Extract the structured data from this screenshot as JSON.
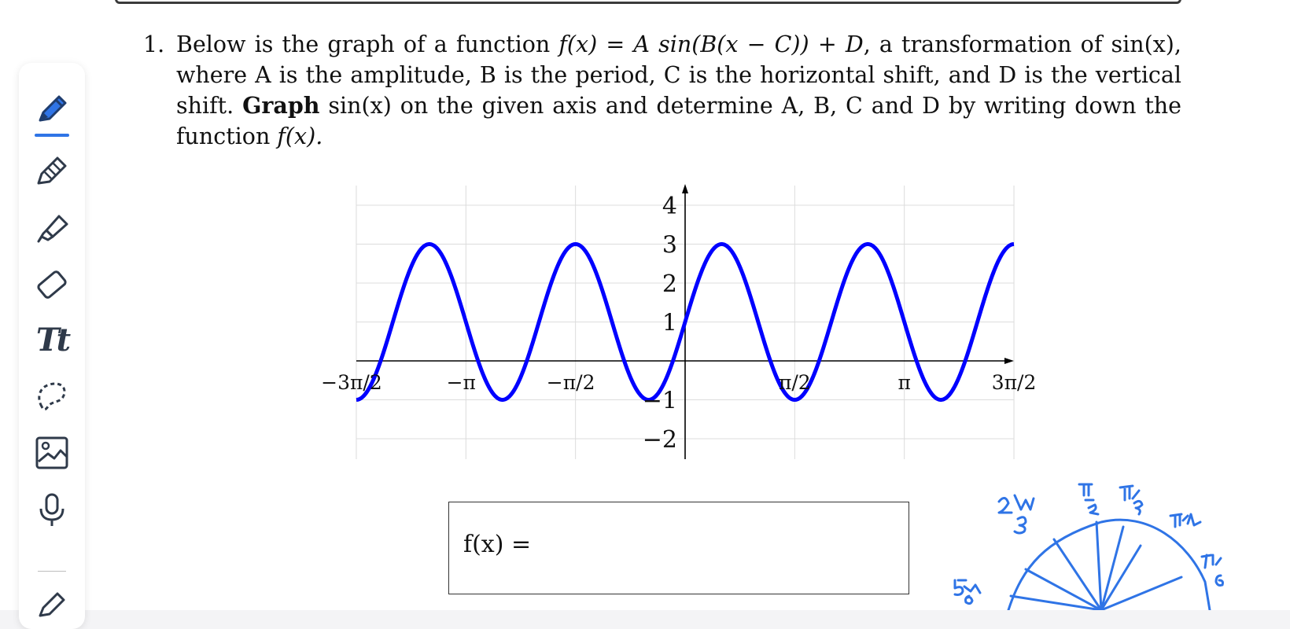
{
  "question": {
    "number": "1.",
    "line1_prefix": "Below is the graph of a function ",
    "function_form": "f(x) = A sin(B(x − C)) + D",
    "line1_suffix": ", a transformation of sin(x),",
    "line2": "where A is the amplitude, B is the period, C is the horizontal shift, and D is the vertical shift.",
    "line3_bold": "Graph",
    "line3_rest": " sin(x) on the given axis and determine A, B, C and D by writing down the function",
    "line4": "f(x)."
  },
  "answer_box": {
    "label": "f(x) ="
  },
  "chart_data": {
    "type": "line",
    "function_plotted": "2 sin(3x) + 1",
    "xlim": [
      -4.712,
      4.712
    ],
    "ylim": [
      -2.5,
      4.2
    ],
    "x_ticks": [
      "−3π/2",
      "−π",
      "−π/2",
      "π/2",
      "π",
      "3π/2"
    ],
    "y_ticks": [
      "4",
      "3",
      "2",
      "1",
      "−1",
      "−2"
    ],
    "grid": true,
    "series_color": "#0000ff",
    "maximum": 3,
    "minimum": -1
  },
  "sketch": {
    "labels": [
      "2π/3",
      "π/2",
      "π/3",
      "π/4",
      "π/6",
      "5π/6"
    ],
    "color": "#2f74e6"
  },
  "toolbar": {
    "tools": [
      "pen-icon",
      "pencil-icon",
      "highlighter-icon",
      "eraser-icon",
      "text-icon",
      "lasso-icon",
      "image-icon",
      "microphone-icon",
      "shape-icon"
    ],
    "text_tool_glyph": "Tt",
    "active_color": "#2f74e6"
  }
}
